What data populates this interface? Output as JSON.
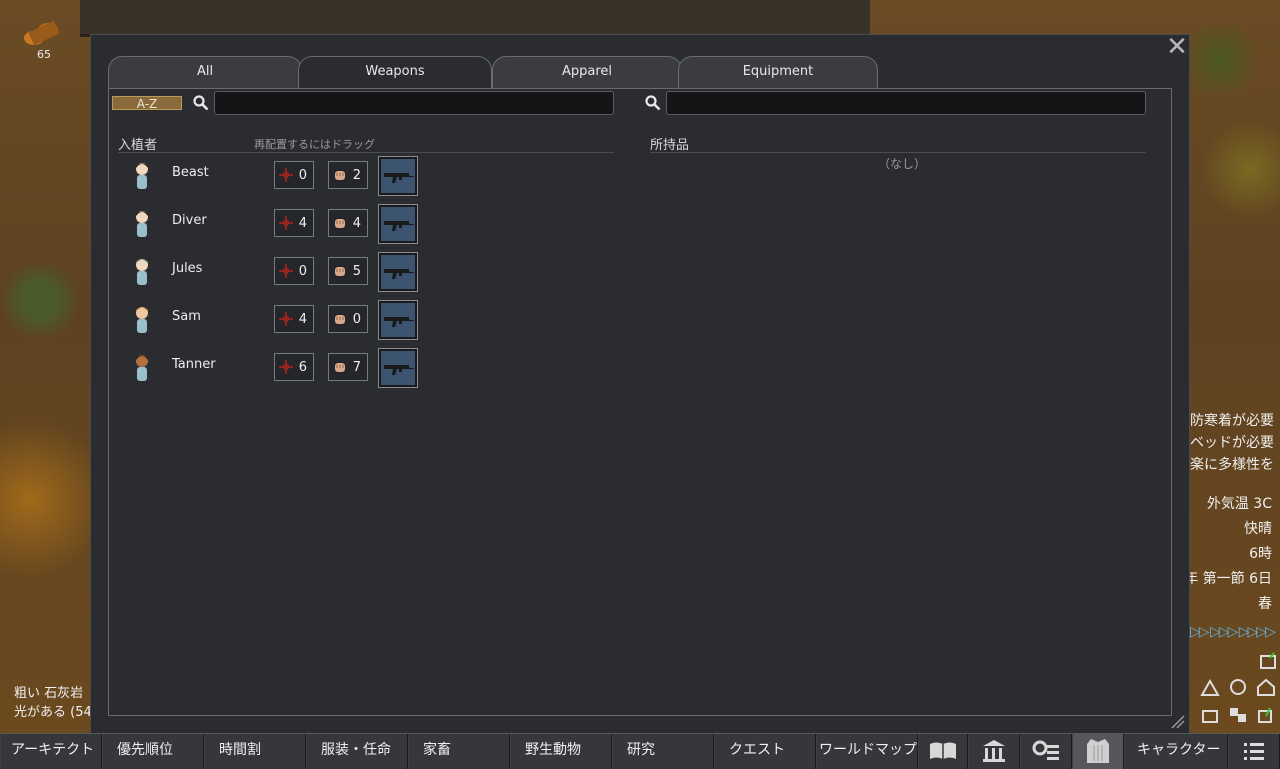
{
  "map": {
    "wood_count": "65",
    "left_info": [
      "粗い 石灰岩",
      "光がある (54"
    ],
    "alerts": [
      "防寒着が必要",
      "ベッドが必要",
      "楽に多様性を"
    ],
    "status": [
      "外気温 3C",
      "快晴",
      "6時",
      "年 第一節 6日",
      "春"
    ],
    "speed": "▷▷ ▷▷▷ ▷▷▷▷"
  },
  "dialog": {
    "tabs": [
      "All",
      "Weapons",
      "Apparel",
      "Equipment"
    ],
    "active_tab": "Weapons",
    "sort_label": "A-Z",
    "left_search": {
      "value": "",
      "placeholder": ""
    },
    "right_search": {
      "value": "",
      "placeholder": ""
    },
    "colonists_header": "入植者",
    "drag_hint": "再配置するにはドラッグ",
    "inventory_header": "所持品",
    "inventory_empty": "（なし）",
    "colonists": [
      {
        "name": "Beast",
        "shooting": "0",
        "melee": "2"
      },
      {
        "name": "Diver",
        "shooting": "4",
        "melee": "4"
      },
      {
        "name": "Jules",
        "shooting": "0",
        "melee": "5"
      },
      {
        "name": "Sam",
        "shooting": "4",
        "melee": "0"
      },
      {
        "name": "Tanner",
        "shooting": "6",
        "melee": "7"
      }
    ]
  },
  "bottom_bar": {
    "architect": "アーキテクト",
    "priority": "優先順位",
    "schedule": "時間割",
    "assign": "服装・任命",
    "animals": "家畜",
    "wildlife": "野生動物",
    "research": "研究",
    "quests": "クエスト",
    "world": "ワールドマップ",
    "characters": "キャラクター"
  },
  "colors": {
    "accent_blue": "#5fb4e8",
    "sort_button": "#8a6a3a",
    "weapon_slot": "#3d5470"
  }
}
